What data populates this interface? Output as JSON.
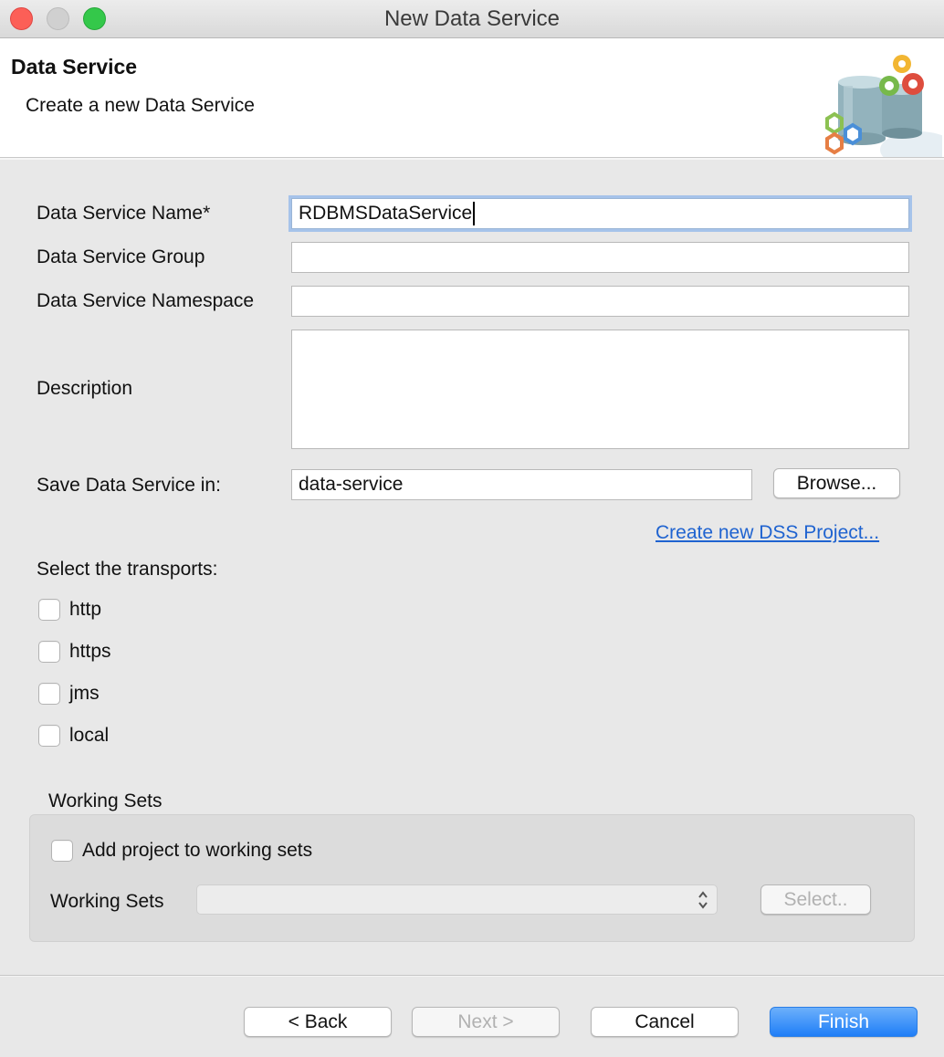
{
  "window": {
    "title": "New Data Service"
  },
  "header": {
    "title": "Data Service",
    "subtitle": "Create a new Data Service",
    "logo_icon": "data-service-gears-icon"
  },
  "form": {
    "name_label": "Data Service Name*",
    "name_value": "RDBMSDataService",
    "group_label": "Data Service Group",
    "group_value": "",
    "namespace_label": "Data Service Namespace",
    "namespace_value": "",
    "description_label": "Description",
    "description_value": "",
    "save_label": "Save Data Service in:",
    "save_value": "data-service",
    "browse_label": "Browse...",
    "create_project_link": "Create new DSS Project..."
  },
  "transports": {
    "label": "Select the transports:",
    "items": [
      {
        "label": "http",
        "checked": false
      },
      {
        "label": "https",
        "checked": false
      },
      {
        "label": "jms",
        "checked": false
      },
      {
        "label": "local",
        "checked": false
      }
    ]
  },
  "working_sets": {
    "group_title": "Working Sets",
    "add_label": "Add project to working sets",
    "add_checked": false,
    "sets_label": "Working Sets",
    "sets_value": "",
    "select_label": "Select.."
  },
  "buttons": {
    "back": "< Back",
    "next": "Next >",
    "cancel": "Cancel",
    "finish": "Finish"
  },
  "colors": {
    "accent": "#1f7ef7",
    "link": "#1f63d0",
    "focus": "#a6c3ea"
  }
}
